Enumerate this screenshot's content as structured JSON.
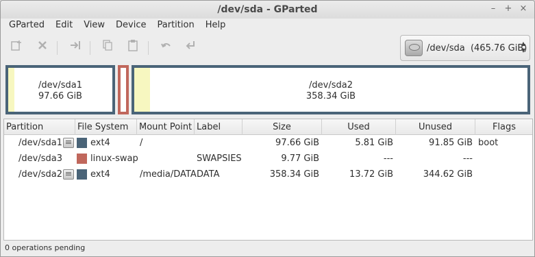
{
  "window": {
    "title": "/dev/sda - GParted",
    "buttons": [
      "–",
      "+",
      "×"
    ]
  },
  "menubar": {
    "items": [
      "GParted",
      "Edit",
      "View",
      "Device",
      "Partition",
      "Help"
    ]
  },
  "toolbar": {
    "new_icon": "new-partition-icon",
    "delete_icon": "delete-icon",
    "resize_icon": "resize-move-icon",
    "copy_icon": "copy-icon",
    "paste_icon": "paste-icon",
    "undo_icon": "undo-icon",
    "apply_icon": "apply-icon"
  },
  "device": {
    "label": "/dev/sda  (465.76 GiB)",
    "icon": "hard-disk-icon"
  },
  "diskmap": {
    "partitions": [
      {
        "name": "/dev/sda1",
        "size": "97.66 GiB",
        "used_fraction": 0.06,
        "color": "#4a6478"
      },
      {
        "name": "",
        "size": "",
        "used_fraction": 0.0,
        "color": "#c0675c"
      },
      {
        "name": "/dev/sda2",
        "size": "358.34 GiB",
        "used_fraction": 0.04,
        "color": "#4a6478"
      }
    ]
  },
  "table": {
    "columns": [
      "Partition",
      "File System",
      "Mount Point",
      "Label",
      "Size",
      "Used",
      "Unused",
      "Flags"
    ],
    "rows": [
      {
        "partition": "/dev/sda1",
        "has_info": true,
        "fs": "ext4",
        "fs_color": "#4a6478",
        "mount": "/",
        "label": "",
        "size": "97.66 GiB",
        "used": "5.81 GiB",
        "unused": "91.85 GiB",
        "flags": "boot"
      },
      {
        "partition": "/dev/sda3",
        "has_info": false,
        "fs": "linux-swap",
        "fs_color": "#c0675c",
        "mount": "",
        "label": "SWAPSIES",
        "size": "9.77 GiB",
        "used": "---",
        "unused": "---",
        "flags": ""
      },
      {
        "partition": "/dev/sda2",
        "has_info": true,
        "fs": "ext4",
        "fs_color": "#4a6478",
        "mount": "/media/DATA",
        "label": "DATA",
        "size": "358.34 GiB",
        "used": "13.72 GiB",
        "unused": "344.62 GiB",
        "flags": ""
      }
    ]
  },
  "status": {
    "text": "0 operations pending"
  }
}
